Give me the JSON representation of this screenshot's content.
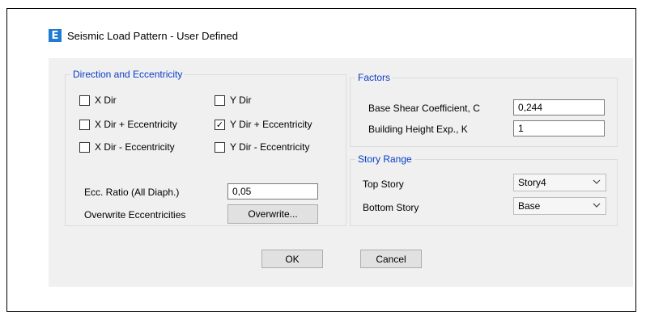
{
  "window": {
    "title": "Seismic Load Pattern - User Defined",
    "icon_glyph": "E"
  },
  "direction_group": {
    "label": "Direction and Eccentricity",
    "checkboxes": [
      {
        "label": "X Dir",
        "checked": false
      },
      {
        "label": "Y Dir",
        "checked": false
      },
      {
        "label": "X Dir + Eccentricity",
        "checked": false
      },
      {
        "label": "Y Dir + Eccentricity",
        "checked": true
      },
      {
        "label": "X Dir - Eccentricity",
        "checked": false
      },
      {
        "label": "Y Dir - Eccentricity",
        "checked": false
      }
    ],
    "ecc_ratio_label": "Ecc. Ratio (All Diaph.)",
    "ecc_ratio_value": "0,05",
    "overwrite_label": "Overwrite Eccentricities",
    "overwrite_button": "Overwrite..."
  },
  "factors_group": {
    "label": "Factors",
    "base_shear_label": "Base Shear Coefficient, C",
    "base_shear_value": "0,244",
    "height_exp_label": "Building Height Exp., K",
    "height_exp_value": "1"
  },
  "story_range_group": {
    "label": "Story Range",
    "top_story_label": "Top Story",
    "top_story_value": "Story4",
    "bottom_story_label": "Bottom Story",
    "bottom_story_value": "Base"
  },
  "buttons": {
    "ok": "OK",
    "cancel": "Cancel"
  },
  "colors": {
    "group_label": "#0a3cc8",
    "icon_bg": "#1f7ad6",
    "dialog_bg": "#f0f0f0"
  }
}
